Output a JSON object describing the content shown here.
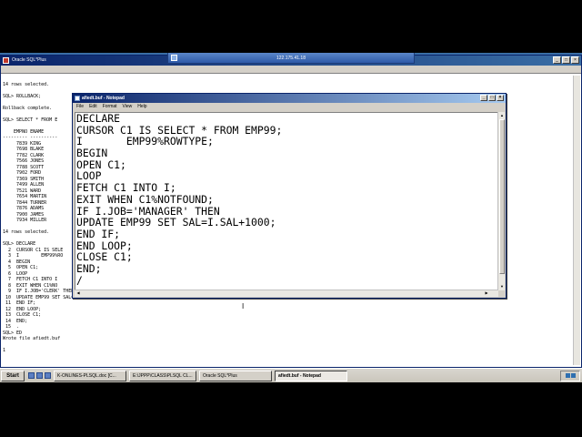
{
  "rdp": {
    "title": "122.175.41.18"
  },
  "sqlplus": {
    "title": "Oracle SQL*Plus",
    "lines": [
      "",
      "14 rows selected.",
      "",
      "SQL> ROLLBACK;",
      "",
      "Rollback complete.",
      "",
      "SQL> SELECT * FROM E",
      "",
      "    EMPNO ENAME",
      "--------- ----------",
      "     7839 KING",
      "     7698 BLAKE",
      "     7782 CLARK",
      "     7566 JONES",
      "     7788 SCOTT",
      "     7902 FORD",
      "     7369 SMITH",
      "     7499 ALLEN",
      "     7521 WARD",
      "     7654 MARTIN",
      "     7844 TURNER",
      "     7876 ADAMS",
      "     7900 JAMES",
      "     7934 MILLER",
      "",
      "14 rows selected.",
      "",
      "SQL> DECLARE",
      "  2  CURSOR C1 IS SELE",
      "  3  I        EMP99%RO",
      "  4  BEGIN",
      "  5  OPEN C1;",
      "  6  LOOP",
      "  7  FETCH C1 INTO I",
      "  8  EXIT WHEN C1%NO",
      "  9  IF I.JOB='CLERK' THEN",
      " 10  UPDATE EMP99 SET SAL=I.SAL+1000;",
      " 11  END IF;",
      " 12  END LOOP;",
      " 13  CLOSE C1;",
      " 14  END;",
      " 15  .",
      "SQL> ED",
      "Wrote file afiedt.buf",
      "",
      "1"
    ]
  },
  "notepad": {
    "title": "afiedt.buf - Notepad",
    "menu": [
      "File",
      "Edit",
      "Format",
      "View",
      "Help"
    ],
    "lines": [
      "DECLARE",
      "CURSOR C1 IS SELECT * FROM EMP99;",
      "I       EMP99%ROWTYPE;",
      "BEGIN",
      "OPEN C1;",
      "LOOP",
      "FETCH C1 INTO I;",
      "EXIT WHEN C1%NOTFOUND;",
      "IF I.JOB='MANAGER' THEN",
      "UPDATE EMP99 SET SAL=I.SAL+1000;",
      "END IF;",
      "END LOOP;",
      "CLOSE C1;",
      "END;",
      "/"
    ]
  },
  "taskbar": {
    "start": "Start",
    "tasks": [
      "K-ONLINES-PLSQL.doc [C...",
      "E:\\JPPP\\CLASS\\PLSQL CL...",
      "Oracle SQL*Plus",
      "afiedt.buf - Notepad"
    ]
  },
  "colors": {
    "desktop": "#3a6ea5",
    "titlebar": "#0a246a"
  }
}
